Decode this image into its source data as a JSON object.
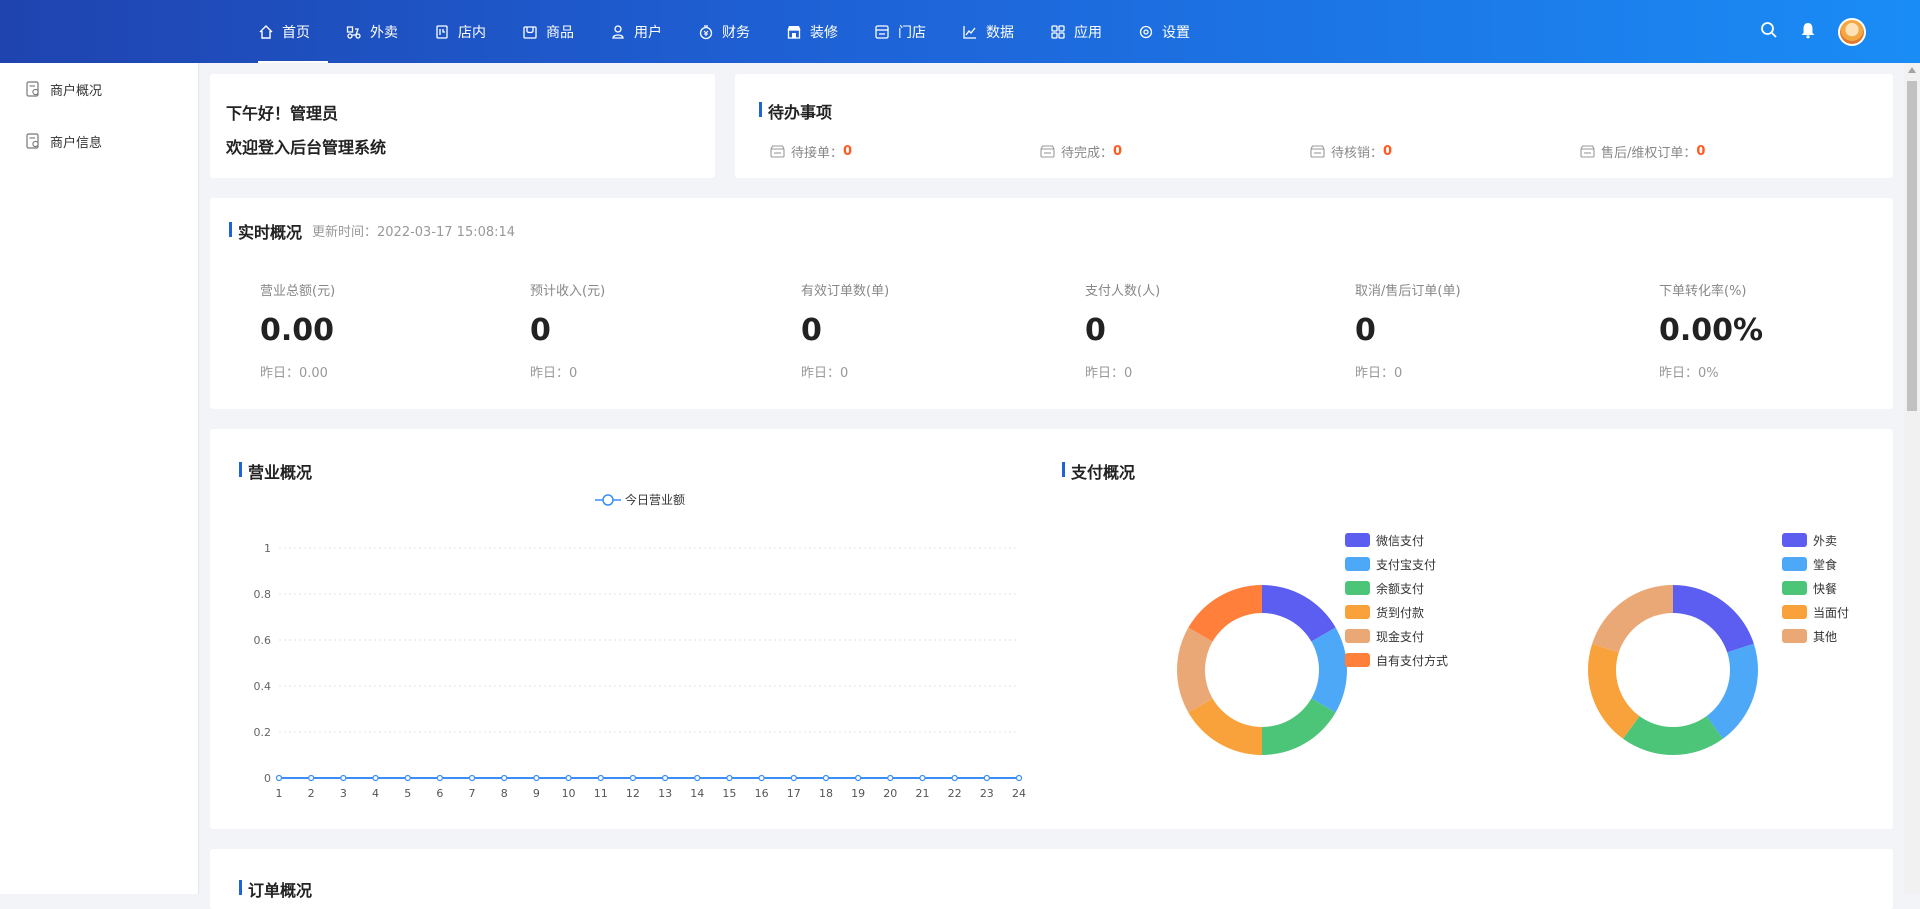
{
  "nav": {
    "items": [
      {
        "label": "首页",
        "icon": "home-icon"
      },
      {
        "label": "外卖",
        "icon": "takeout-icon"
      },
      {
        "label": "店内",
        "icon": "dine-in-icon"
      },
      {
        "label": "商品",
        "icon": "goods-icon"
      },
      {
        "label": "用户",
        "icon": "user-icon"
      },
      {
        "label": "财务",
        "icon": "finance-icon"
      },
      {
        "label": "装修",
        "icon": "shop-decor-icon"
      },
      {
        "label": "门店",
        "icon": "store-icon"
      },
      {
        "label": "数据",
        "icon": "chart-icon"
      },
      {
        "label": "应用",
        "icon": "apps-icon"
      },
      {
        "label": "设置",
        "icon": "gear-icon"
      }
    ],
    "active_index": 0
  },
  "sidebar": {
    "items": [
      {
        "label": "商户概况"
      },
      {
        "label": "商户信息"
      }
    ]
  },
  "greeting": {
    "line1": "下午好！管理员",
    "line2": "欢迎登入后台管理系统"
  },
  "todo": {
    "title": "待办事项",
    "items": [
      {
        "label": "待接单：",
        "value": "0"
      },
      {
        "label": "待完成：",
        "value": "0"
      },
      {
        "label": "待核销：",
        "value": "0"
      },
      {
        "label": "售后/维权订单：",
        "value": "0"
      }
    ]
  },
  "realtime": {
    "title": "实时概况",
    "update_time": "更新时间：2022-03-17 15:08:14",
    "metrics": [
      {
        "label": "营业总额(元)",
        "value": "0.00",
        "yesterday": "昨日：0.00"
      },
      {
        "label": "预计收入(元)",
        "value": "0",
        "yesterday": "昨日：0"
      },
      {
        "label": "有效订单数(单)",
        "value": "0",
        "yesterday": "昨日：0"
      },
      {
        "label": "支付人数(人)",
        "value": "0",
        "yesterday": "昨日：0"
      },
      {
        "label": "取消/售后订单(单)",
        "value": "0",
        "yesterday": "昨日：0"
      },
      {
        "label": "下单转化率(%)",
        "value": "0.00%",
        "yesterday": "昨日：0%"
      }
    ]
  },
  "business": {
    "title": "营业概况"
  },
  "payment": {
    "title": "支付概况"
  },
  "orders": {
    "title": "订单概况"
  },
  "chart_data": [
    {
      "type": "line",
      "series": [
        {
          "name": "今日营业额",
          "values": [
            0,
            0,
            0,
            0,
            0,
            0,
            0,
            0,
            0,
            0,
            0,
            0,
            0,
            0,
            0,
            0,
            0,
            0,
            0,
            0,
            0,
            0,
            0,
            0
          ]
        }
      ],
      "x": [
        "1",
        "2",
        "3",
        "4",
        "5",
        "6",
        "7",
        "8",
        "9",
        "10",
        "11",
        "12",
        "13",
        "14",
        "15",
        "16",
        "17",
        "18",
        "19",
        "20",
        "21",
        "22",
        "23",
        "24"
      ],
      "yticks": [
        "0",
        "0.2",
        "0.4",
        "0.6",
        "0.8",
        "1"
      ],
      "ylim": [
        0,
        1
      ],
      "grid": true,
      "legend_position": "top-center",
      "color": "#3a8ef6"
    },
    {
      "type": "pie",
      "donut": true,
      "labels": [
        "微信支付",
        "支付宝支付",
        "余额支付",
        "货到付款",
        "现金支付",
        "自有支付方式"
      ],
      "values": [
        1,
        1,
        1,
        1,
        1,
        1
      ],
      "colors": [
        "#5b5ef0",
        "#4ea8f8",
        "#4cc579",
        "#f9a13a",
        "#eba877",
        "#ff7f3b"
      ],
      "legend_position": "right"
    },
    {
      "type": "pie",
      "donut": true,
      "labels": [
        "外卖",
        "堂食",
        "快餐",
        "当面付",
        "其他"
      ],
      "values": [
        1,
        1,
        1,
        1,
        1
      ],
      "colors": [
        "#5b5ef0",
        "#4ea8f8",
        "#4cc579",
        "#f9a13a",
        "#eba877"
      ],
      "legend_position": "right"
    }
  ]
}
